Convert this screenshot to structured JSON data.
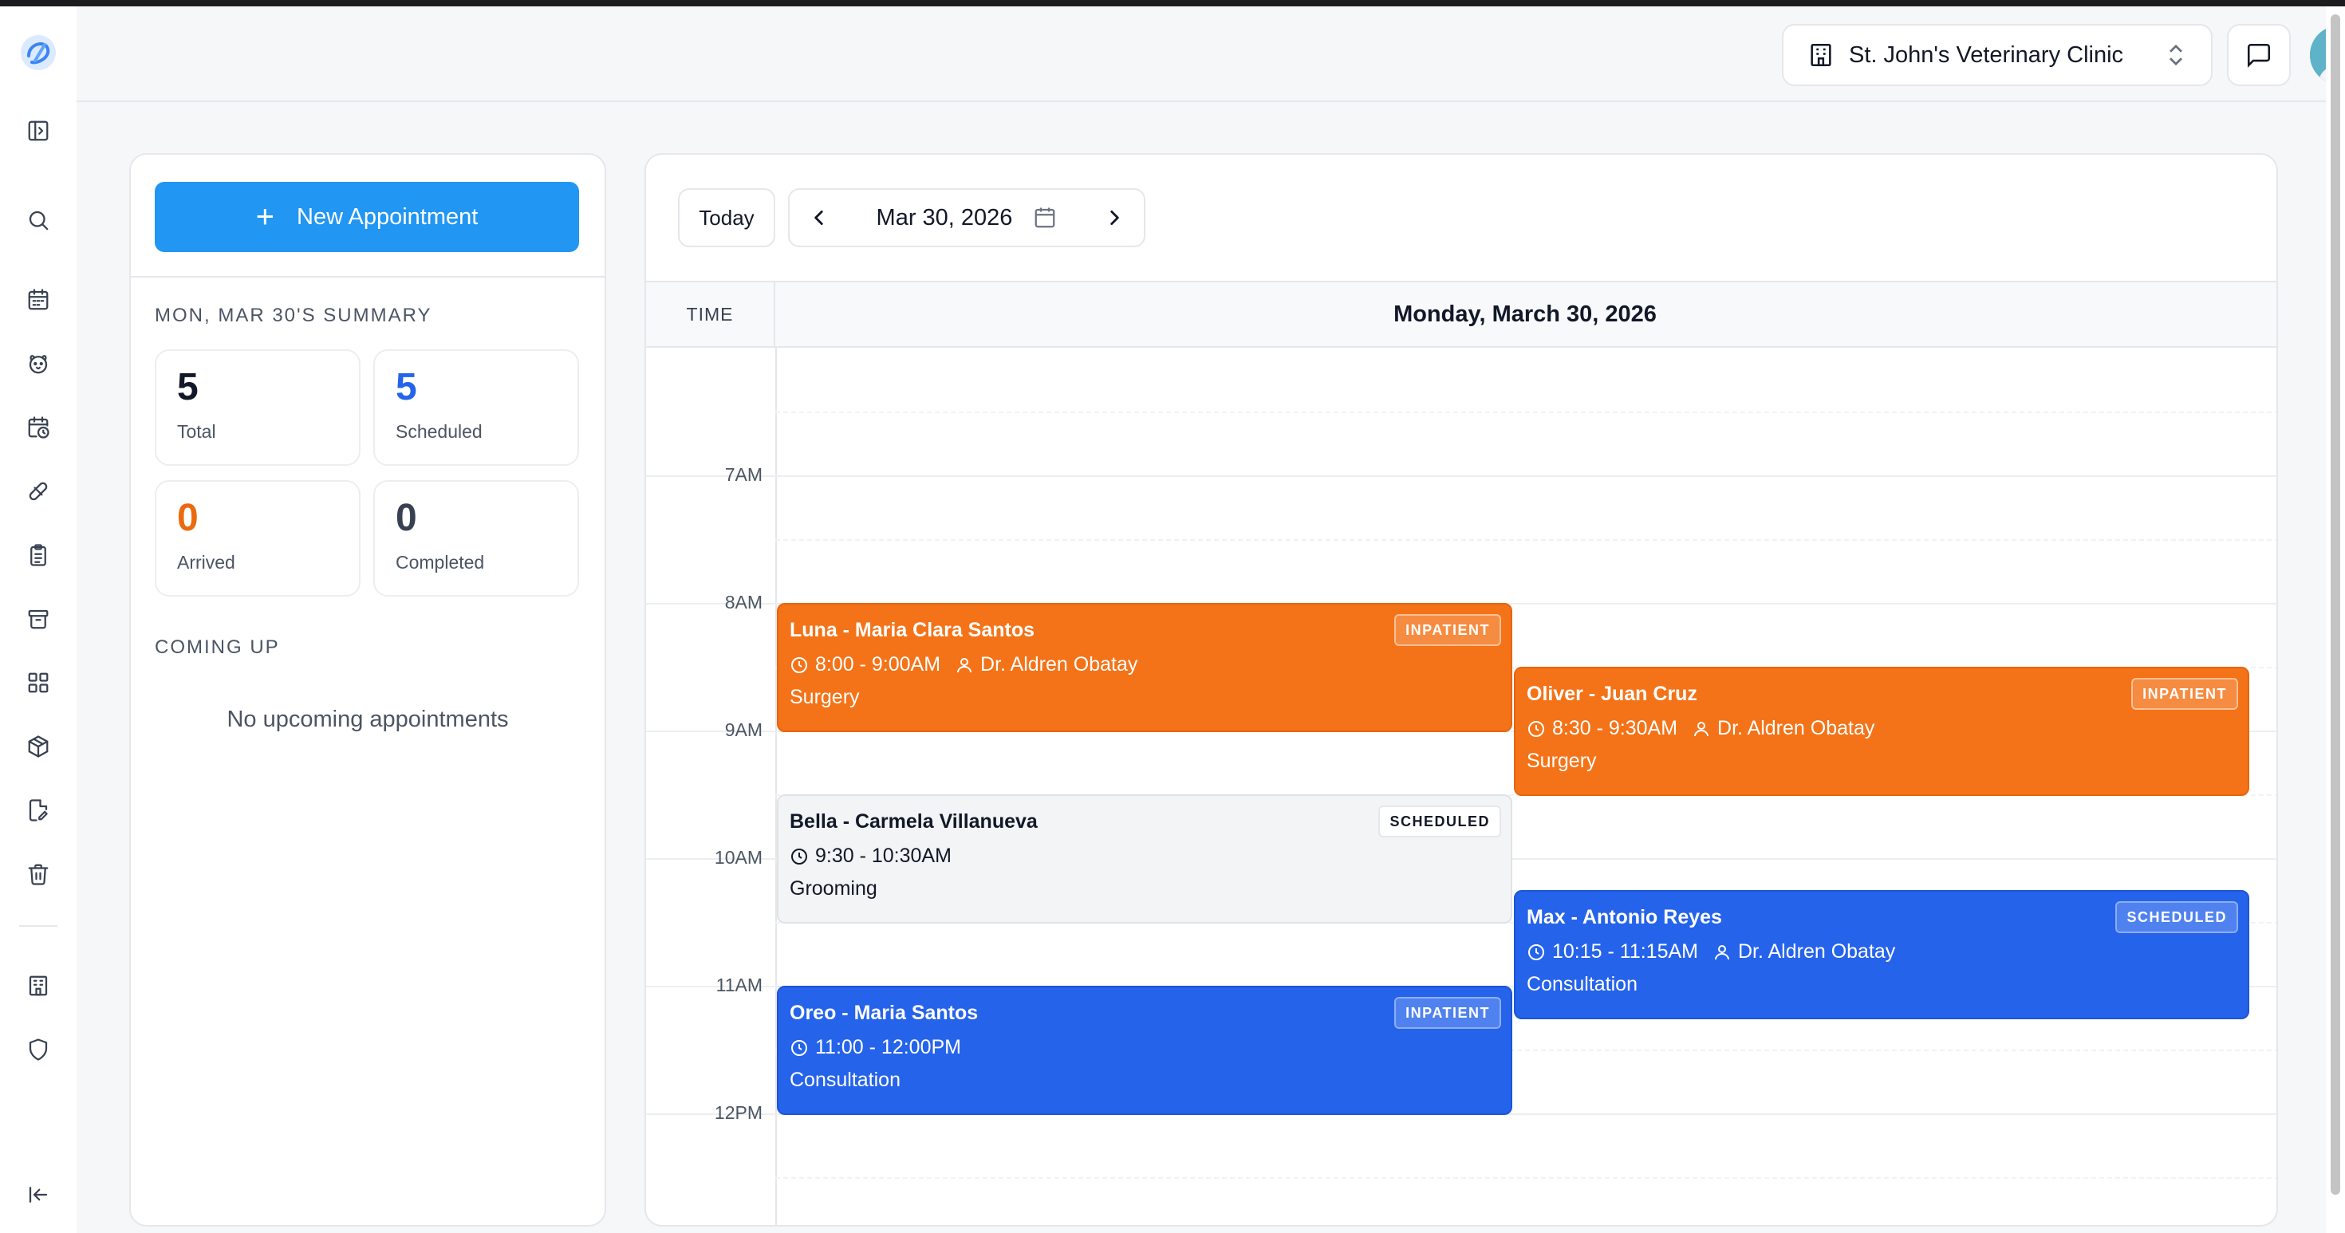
{
  "header": {
    "clinic_name": "St. John's Veterinary Clinic"
  },
  "sidebar": {
    "icons": [
      "sidebar-toggle-icon",
      "search-icon",
      "calendar-icon",
      "pet-icon",
      "calendar-clock-icon",
      "pill-icon",
      "clipboard-icon",
      "archive-icon",
      "grid-icon",
      "package-icon",
      "file-edit-icon",
      "trash-icon",
      "building-icon",
      "shield-icon",
      "collapse-icon"
    ]
  },
  "left_panel": {
    "new_appointment_label": "New Appointment",
    "summary_title": "MON, MAR 30'S SUMMARY",
    "stats": [
      {
        "value": "5",
        "label": "Total",
        "color": "#111827"
      },
      {
        "value": "5",
        "label": "Scheduled",
        "color": "#2563eb"
      },
      {
        "value": "0",
        "label": "Arrived",
        "color": "#ea6a12"
      },
      {
        "value": "0",
        "label": "Completed",
        "color": "#374151"
      }
    ],
    "coming_up_title": "COMING UP",
    "no_upcoming": "No upcoming appointments"
  },
  "calendar": {
    "today_label": "Today",
    "current_date": "Mar 30, 2026",
    "time_header": "TIME",
    "day_header": "Monday, March 30, 2026",
    "hours": [
      "7AM",
      "8AM",
      "9AM",
      "10AM",
      "11AM",
      "12PM"
    ],
    "appointments": [
      {
        "title": "Luna - Maria Clara Santos",
        "time": "8:00 - 9:00AM",
        "doctor": "Dr. Aldren Obatay",
        "service": "Surgery",
        "status": "INPATIENT",
        "color": "orange"
      },
      {
        "title": "Oliver - Juan Cruz",
        "time": "8:30 - 9:30AM",
        "doctor": "Dr. Aldren Obatay",
        "service": "Surgery",
        "status": "INPATIENT",
        "color": "orange"
      },
      {
        "title": "Bella - Carmela Villanueva",
        "time": "9:30 - 10:30AM",
        "doctor": "",
        "service": "Grooming",
        "status": "SCHEDULED",
        "color": "gray"
      },
      {
        "title": "Max - Antonio Reyes",
        "time": "10:15 - 11:15AM",
        "doctor": "Dr. Aldren Obatay",
        "service": "Consultation",
        "status": "SCHEDULED",
        "color": "blue"
      },
      {
        "title": "Oreo - Maria Santos",
        "time": "11:00 - 12:00PM",
        "doctor": "",
        "service": "Consultation",
        "status": "INPATIENT",
        "color": "blue"
      }
    ]
  }
}
